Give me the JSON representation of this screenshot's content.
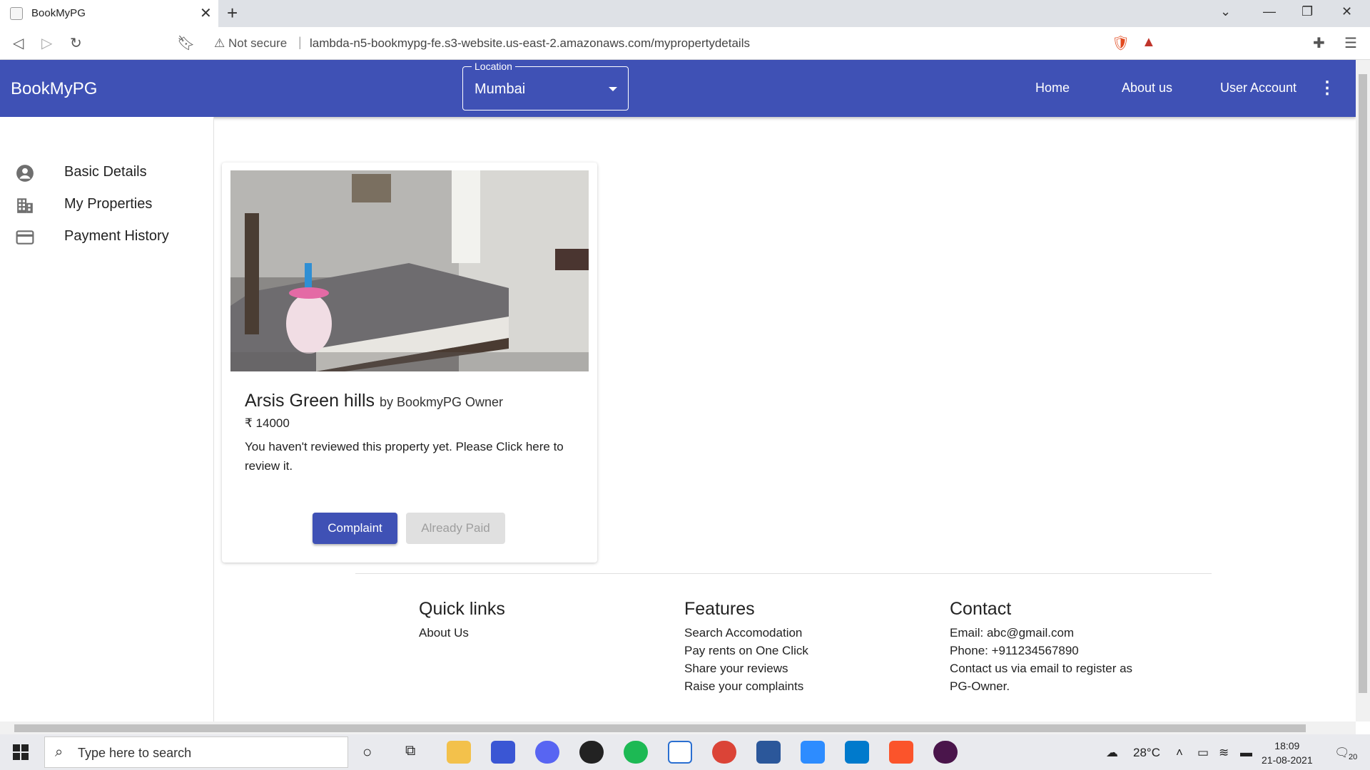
{
  "browser": {
    "tab_title": "BookMyPG",
    "url_warning": "Not secure",
    "url": "lambda-n5-bookmypg-fe.s3-website.us-east-2.amazonaws.com/mypropertydetails"
  },
  "header": {
    "brand": "BookMyPG",
    "location_label": "Location",
    "location_value": "Mumbai",
    "nav": [
      "Home",
      "About us",
      "User Account"
    ]
  },
  "sidebar": {
    "items": [
      {
        "label": "Basic Details",
        "icon": "account-circle-icon"
      },
      {
        "label": "My Properties",
        "icon": "building-icon"
      },
      {
        "label": "Payment History",
        "icon": "credit-card-icon"
      }
    ]
  },
  "property": {
    "title": "Arsis Green hills",
    "owner": "by BookmyPG Owner",
    "price": "₹ 14000",
    "review_note": "You haven't reviewed this property yet. Please Click here to review it.",
    "complaint_label": "Complaint",
    "paid_label": "Already Paid"
  },
  "footer": {
    "quick_links": {
      "title": "Quick links",
      "items": [
        "About Us"
      ]
    },
    "features": {
      "title": "Features",
      "items": [
        "Search Accomodation",
        "Pay rents on One Click",
        "Share your reviews",
        "Raise your complaints"
      ]
    },
    "contact": {
      "title": "Contact",
      "items": [
        "Email: abc@gmail.com",
        "Phone: +911234567890",
        "Contact us via email to register as",
        "PG-Owner."
      ]
    }
  },
  "taskbar": {
    "search_placeholder": "Type here to search",
    "temperature": "28°C",
    "time": "18:09",
    "date": "21-08-2021",
    "notification_count": "20"
  },
  "colors": {
    "primary": "#3f51b5",
    "disabled_bg": "#e0e0e0"
  }
}
